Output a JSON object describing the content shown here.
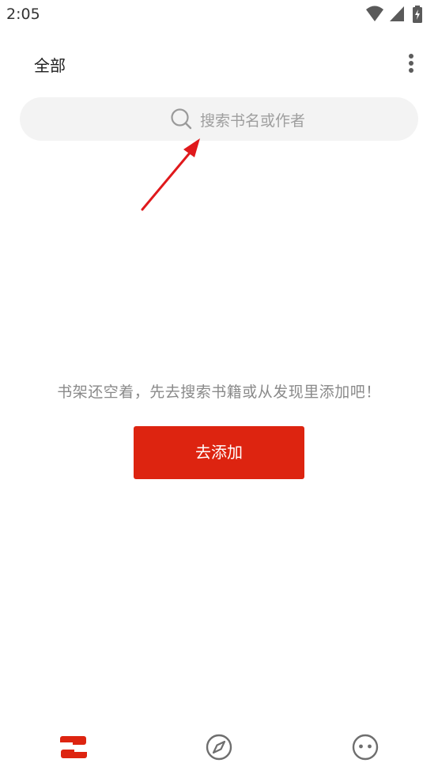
{
  "status_bar": {
    "time": "2:05",
    "icons": [
      "wifi-icon",
      "signal-icon",
      "battery-charging-icon"
    ]
  },
  "header": {
    "title": "全部",
    "more_icon": "more-vertical-icon"
  },
  "search": {
    "placeholder": "搜索书名或作者",
    "icon": "search-icon"
  },
  "empty_state": {
    "message": "书架还空着，先去搜索书籍或从发现里添加吧！",
    "button_label": "去添加"
  },
  "bottom_nav": {
    "items": [
      {
        "icon": "bookshelf-icon",
        "active": true
      },
      {
        "icon": "compass-icon",
        "active": false
      },
      {
        "icon": "face-icon",
        "active": false
      }
    ]
  },
  "colors": {
    "accent": "#dd2410",
    "annotation": "#e0191c",
    "placeholder": "#9e9e9e",
    "message": "#8a8a8a",
    "search_bg": "#f3f3f3"
  }
}
